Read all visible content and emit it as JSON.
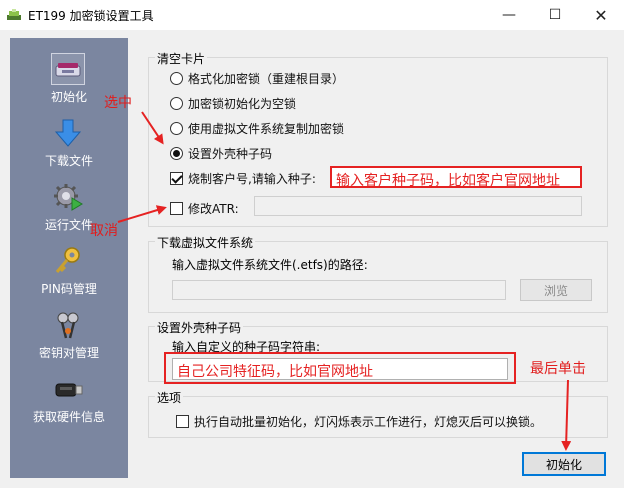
{
  "window": {
    "title": "ET199 加密锁设置工具",
    "min_glyph": "—",
    "max_glyph": "☐",
    "close_glyph": "✕"
  },
  "sidebar": {
    "items": [
      {
        "label": "初始化",
        "icon": "usb-key-icon",
        "active": true
      },
      {
        "label": "下载文件",
        "icon": "download-arrow-icon"
      },
      {
        "label": "运行文件",
        "icon": "gear-run-icon"
      },
      {
        "label": "PIN码管理",
        "icon": "key-icon"
      },
      {
        "label": "密钥对管理",
        "icon": "key-pair-icon"
      },
      {
        "label": "获取硬件信息",
        "icon": "hardware-dongle-icon"
      }
    ]
  },
  "clear_card": {
    "legend": "清空卡片",
    "options": [
      "格式化加密锁（重建根目录）",
      "加密锁初始化为空锁",
      "使用虚拟文件系统复制加密锁",
      "设置外壳种子码"
    ],
    "selected_index": 3,
    "burn_label": "烧制客户号,请输入种子:",
    "burn_value": "输入客户种子码，比如客户官网地址",
    "modify_atr_label": "修改ATR:"
  },
  "download_vfs": {
    "legend": "下载虚拟文件系统",
    "path_label": "输入虚拟文件系统文件(.etfs)的路径:",
    "browse_label": "浏览"
  },
  "shell_seed": {
    "legend": "设置外壳种子码",
    "input_label": "输入自定义的种子码字符串:",
    "input_value": "自己公司特征码，比如官网地址"
  },
  "options": {
    "legend": "选项",
    "batch_label": "执行自动批量初始化，灯闪烁表示工作进行，灯熄灭后可以换锁。"
  },
  "init_button": "初始化",
  "annotations": {
    "select": "选中",
    "cancel": "取消",
    "last_click": "最后单击"
  },
  "colors": {
    "annotation": "#e52222",
    "sidebar": "#7b86a0",
    "focus": "#0078d7"
  }
}
